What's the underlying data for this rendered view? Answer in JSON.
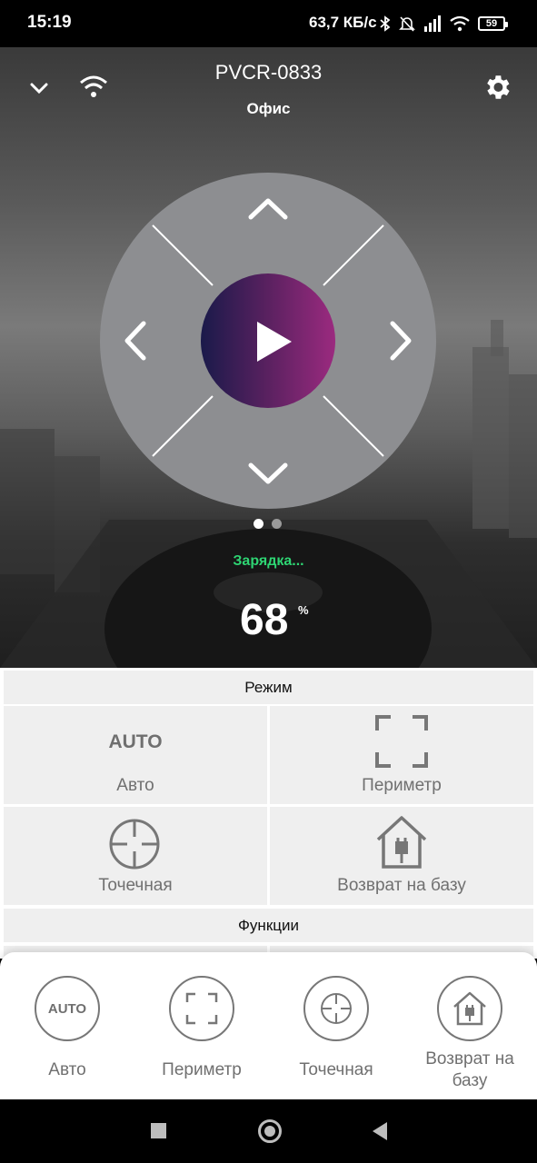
{
  "status_bar": {
    "time": "15:19",
    "network_speed": "63,7 КБ/с",
    "battery": "59",
    "icons": [
      "bluetooth-icon",
      "alarm-off-icon",
      "signal-icon",
      "wifi-icon",
      "battery-icon"
    ]
  },
  "header": {
    "device_name": "PVCR-0833",
    "room": "Офис",
    "left_icons": [
      "chevron-down-icon",
      "wifi-icon"
    ],
    "right_icon": "gear-icon"
  },
  "control": {
    "icons": [
      "arrow-up-icon",
      "arrow-down-icon",
      "arrow-left-icon",
      "arrow-right-icon",
      "play-icon"
    ],
    "page_dots": 2,
    "active_dot": 0
  },
  "robot": {
    "status": "Зарядка...",
    "battery": "68",
    "battery_unit": "%"
  },
  "mode": {
    "header": "Режим",
    "items": [
      {
        "icon_text": "AUTO",
        "label": "Авто"
      },
      {
        "label": "Периметр"
      },
      {
        "label": "Точечная"
      },
      {
        "label": "Возврат на базу"
      }
    ]
  },
  "functions": {
    "header": "Функции"
  },
  "sheet": {
    "items": [
      {
        "icon_text": "AUTO",
        "label": "Авто"
      },
      {
        "label": "Периметр"
      },
      {
        "label": "Точечная"
      },
      {
        "label": "Возврат на базу"
      }
    ]
  },
  "colors": {
    "accent_status": "#2ed573",
    "play_gradient_start": "#1a1a4a",
    "play_gradient_end": "#9b2a7f",
    "joystick": "#8d8e91"
  }
}
